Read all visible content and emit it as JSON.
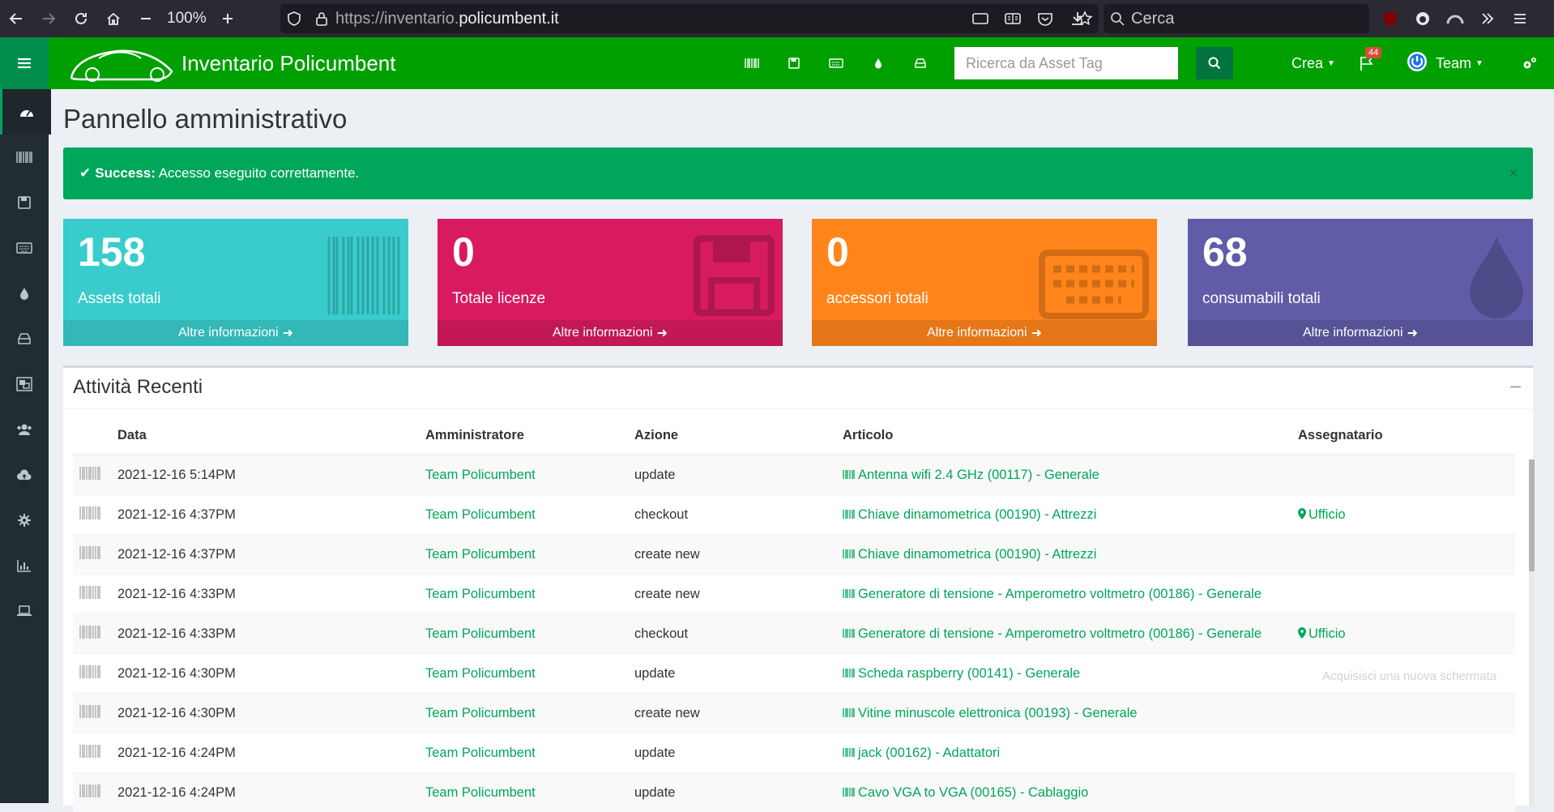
{
  "browser": {
    "zoom": "100%",
    "url_prefix": "https://inventario.",
    "url_domain": "policumbent.it",
    "search_placeholder": "Cerca"
  },
  "header": {
    "brand": "Inventario Policumbent",
    "search_placeholder": "Ricerca da Asset Tag",
    "crea_label": "Crea",
    "notifications_count": "44",
    "user_label": "Team"
  },
  "page": {
    "title": "Pannello amministrativo",
    "alert_strong": "Success:",
    "alert_text": " Accesso eseguito correttamente.",
    "alert_close": "×"
  },
  "stats": [
    {
      "value": "158",
      "label": "Assets totali",
      "more": "Altre informazioni",
      "color": "#39cccc"
    },
    {
      "value": "0",
      "label": "Totale licenze",
      "more": "Altre informazioni",
      "color": "#d81b60"
    },
    {
      "value": "0",
      "label": "accessori totali",
      "more": "Altre informazioni",
      "color": "#ff851b"
    },
    {
      "value": "68",
      "label": "consumabili totali",
      "more": "Altre informazioni",
      "color": "#605ca8"
    }
  ],
  "activity": {
    "title": "Attività Recenti",
    "columns": [
      "Data",
      "Amministratore",
      "Azione",
      "Articolo",
      "Assegnatario"
    ],
    "rows": [
      {
        "date": "2021-12-16 5:14PM",
        "admin": "Team Policumbent",
        "action": "update",
        "item": "Antenna wifi 2.4 GHz (00117) - Generale",
        "assignee": ""
      },
      {
        "date": "2021-12-16 4:37PM",
        "admin": "Team Policumbent",
        "action": "checkout",
        "item": "Chiave dinamometrica (00190) - Attrezzi",
        "assignee": "Ufficio"
      },
      {
        "date": "2021-12-16 4:37PM",
        "admin": "Team Policumbent",
        "action": "create new",
        "item": "Chiave dinamometrica (00190) - Attrezzi",
        "assignee": ""
      },
      {
        "date": "2021-12-16 4:33PM",
        "admin": "Team Policumbent",
        "action": "create new",
        "item": "Generatore di tensione - Amperometro voltmetro (00186) - Generale",
        "assignee": ""
      },
      {
        "date": "2021-12-16 4:33PM",
        "admin": "Team Policumbent",
        "action": "checkout",
        "item": "Generatore di tensione - Amperometro voltmetro (00186) - Generale",
        "assignee": "Ufficio"
      },
      {
        "date": "2021-12-16 4:30PM",
        "admin": "Team Policumbent",
        "action": "update",
        "item": "Scheda raspberry (00141) - Generale",
        "assignee": ""
      },
      {
        "date": "2021-12-16 4:30PM",
        "admin": "Team Policumbent",
        "action": "create new",
        "item": "Vitine minuscole elettronica (00193) - Generale",
        "assignee": ""
      },
      {
        "date": "2021-12-16 4:24PM",
        "admin": "Team Policumbent",
        "action": "update",
        "item": "jack (00162) - Adattatori",
        "assignee": ""
      },
      {
        "date": "2021-12-16 4:24PM",
        "admin": "Team Policumbent",
        "action": "update",
        "item": "Cavo VGA to VGA (00165) - Cablaggio",
        "assignee": ""
      }
    ]
  },
  "tooltip": "Acquisisci una nuova schermata"
}
